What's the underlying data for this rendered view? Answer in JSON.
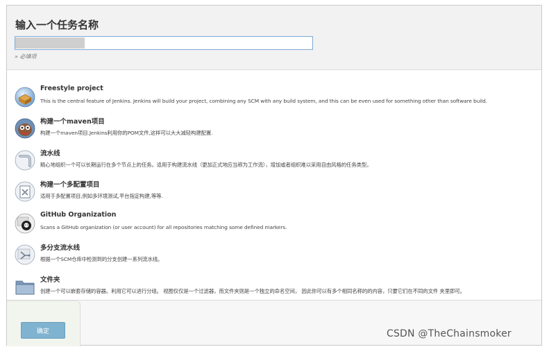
{
  "header": {
    "title": "输入一个任务名称",
    "name_input_value": "",
    "required_hint": "» 必填项"
  },
  "items": [
    {
      "title": "Freestyle project",
      "icon": "freestyle-project-icon",
      "description": "This is the central feature of Jenkins. Jenkins will build your project, combining any SCM with any build system, and this can be even used for something other than software build."
    },
    {
      "title": "构建一个maven项目",
      "icon": "maven-project-icon",
      "description": "构建一个maven项目.Jenkins利用你的POM文件,这样可以大大减轻构建配置."
    },
    {
      "title": "流水线",
      "icon": "pipeline-icon",
      "description": "精心地组织一个可以长期运行在多个节点上的任务。适用于构建流水线（更加正式地应当称为工作流），增加或者组织难以采用自由风格的任务类型。"
    },
    {
      "title": "构建一个多配置项目",
      "icon": "multi-configuration-icon",
      "description": "适用于多配置项目,例如多环境测试,平台指定构建,等等."
    },
    {
      "title": "GitHub Organization",
      "icon": "github-organization-icon",
      "description": "Scans a GitHub organization (or user account) for all repositories matching some defined markers."
    },
    {
      "title": "多分支流水线",
      "icon": "multibranch-pipeline-icon",
      "description": "根据一个SCM仓库中检测到的分支创建一系列流水线。"
    },
    {
      "title": "文件夹",
      "icon": "folder-icon",
      "description": "创建一个可以嵌套存储的容器。利用它可以进行分组。 视图仅仅是一个过滤器，而文件夹则是一个独立的命名空间， 因此你可以有多个相同名称的的内容，只要它们在不同的文件 夹里即可。"
    }
  ],
  "footer": {
    "ok_label": "确定"
  },
  "watermark": "CSDN @TheChainsmoker",
  "colors": {
    "ok_button": "#7fb3d0",
    "input_border": "#7fa7d6",
    "header_bg": "#f2f2f2"
  }
}
